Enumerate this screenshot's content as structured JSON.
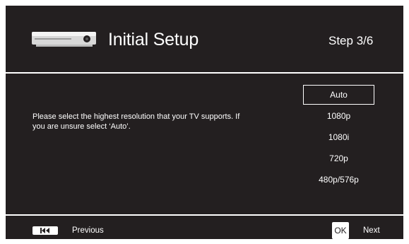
{
  "header": {
    "device_icon": "disc-player-icon",
    "title": "Initial Setup",
    "step": "Step 3/6"
  },
  "main": {
    "instructions": "Please select the highest resolution that your TV supports. If you are unsure select ‘Auto’.",
    "options": [
      {
        "label": "Auto",
        "selected": true
      },
      {
        "label": "1080p",
        "selected": false
      },
      {
        "label": "1080i",
        "selected": false
      },
      {
        "label": "720p",
        "selected": false
      },
      {
        "label": "480p/576p",
        "selected": false
      }
    ]
  },
  "footer": {
    "previous_icon": "skip-back-icon",
    "previous_label": "Previous",
    "ok_label": "OK",
    "next_label": "Next"
  },
  "colors": {
    "background": "#231f20",
    "foreground": "#ffffff"
  }
}
